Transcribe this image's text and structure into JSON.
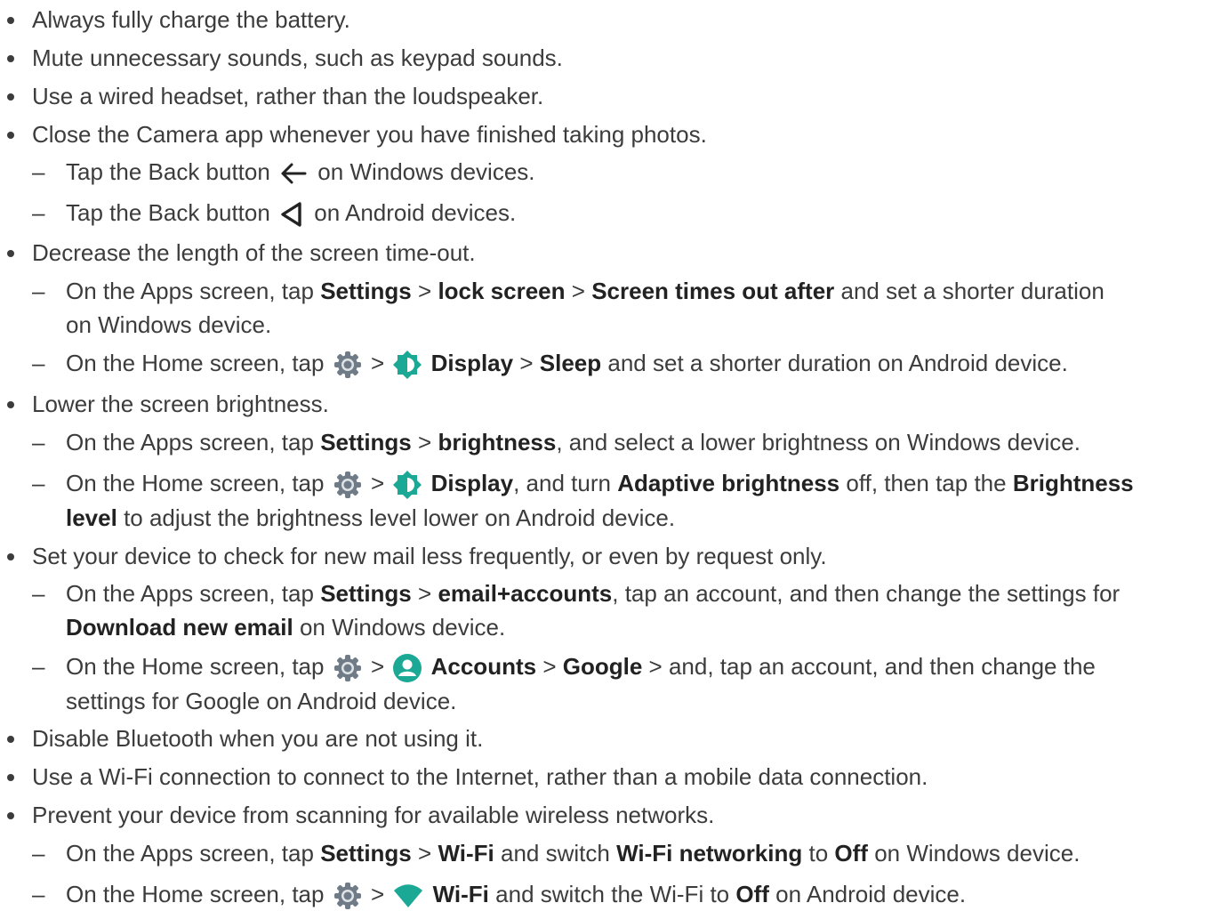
{
  "items": {
    "i1": "Always fully charge the battery.",
    "i2": "Mute unnecessary sounds, such as keypad sounds.",
    "i3": "Use a wired headset, rather than the loudspeaker.",
    "i4": "Close the Camera app whenever you have finished taking photos.",
    "i4a_pre": "Tap the Back button",
    "i4a_post": "on Windows devices.",
    "i4b_pre": "Tap the Back button",
    "i4b_post": "on Android devices.",
    "i5": "Decrease the length of the screen time-out.",
    "i5a_t1": "On the Apps screen, tap",
    "i5a_b1": "Settings",
    "i5a_t2": ">",
    "i5a_b2": "lock screen",
    "i5a_t3": ">",
    "i5a_b3": "Screen times out after",
    "i5a_t4": "and set a shorter duration",
    "i5a_t5": "on Windows device.",
    "i5b_t1": "On the Home screen, tap",
    "i5b_t2": ">",
    "i5b_b1": "Display",
    "i5b_t3": ">",
    "i5b_b2": "Sleep",
    "i5b_t4": "and set a shorter duration on Android device.",
    "i6": "Lower the screen brightness.",
    "i6a_t1": "On the Apps screen, tap",
    "i6a_b1": "Settings",
    "i6a_t2": ">",
    "i6a_b2": "brightness",
    "i6a_t3": ", and select a lower brightness on Windows device.",
    "i6b_t1": "On the Home screen, tap",
    "i6b_t2": ">",
    "i6b_b1": "Display",
    "i6b_t3": ", and turn",
    "i6b_b2": "Adaptive brightness",
    "i6b_t4": "off, then tap the",
    "i6b_b3": "Brightness",
    "i6b_b4": "level",
    "i6b_t5": "to adjust the brightness level lower on Android device.",
    "i7": "Set your device to check for new mail less frequently, or even by request only.",
    "i7a_t1": "On the Apps screen, tap",
    "i7a_b1": "Settings",
    "i7a_t2": ">",
    "i7a_b2": "email+accounts",
    "i7a_t3": ", tap an account, and then change the settings for",
    "i7a_b3": "Download new email",
    "i7a_t4": "on Windows device.",
    "i7b_t1": "On the Home screen, tap",
    "i7b_t2": ">",
    "i7b_b1": "Accounts",
    "i7b_t3": ">",
    "i7b_b2": "Google",
    "i7b_t4": "> and, tap an account, and then change the",
    "i7b_t5": "settings for Google on Android device.",
    "i8": "Disable Bluetooth when you are not using it.",
    "i9": "Use a Wi-Fi connection to connect to the Internet, rather than a mobile data connection.",
    "i10": "Prevent your device from scanning for available wireless networks.",
    "i10a_t1": "On the Apps screen, tap",
    "i10a_b1": "Settings",
    "i10a_t2": ">",
    "i10a_b2": "Wi-Fi",
    "i10a_t3": "and switch",
    "i10a_b3": "Wi-Fi networking",
    "i10a_t4": "to",
    "i10a_b4": "Off",
    "i10a_t5": "on Windows device.",
    "i10b_t1": "On the Home screen, tap",
    "i10b_t2": ">",
    "i10b_b1": "Wi-Fi",
    "i10b_t3": "and switch the Wi-Fi to",
    "i10b_b2": "Off",
    "i10b_t4": "on Android device."
  },
  "dash": "–",
  "icons": {
    "back_arrow": "back-arrow-icon",
    "back_triangle": "back-triangle-icon",
    "settings": "settings-gear-icon",
    "display": "display-brightness-icon",
    "accounts": "accounts-person-icon",
    "wifi": "wifi-icon"
  },
  "colors": {
    "text": "#3c3c3c",
    "bold": "#222222",
    "gear": "#6f7b86",
    "teal": "#1ba996"
  }
}
